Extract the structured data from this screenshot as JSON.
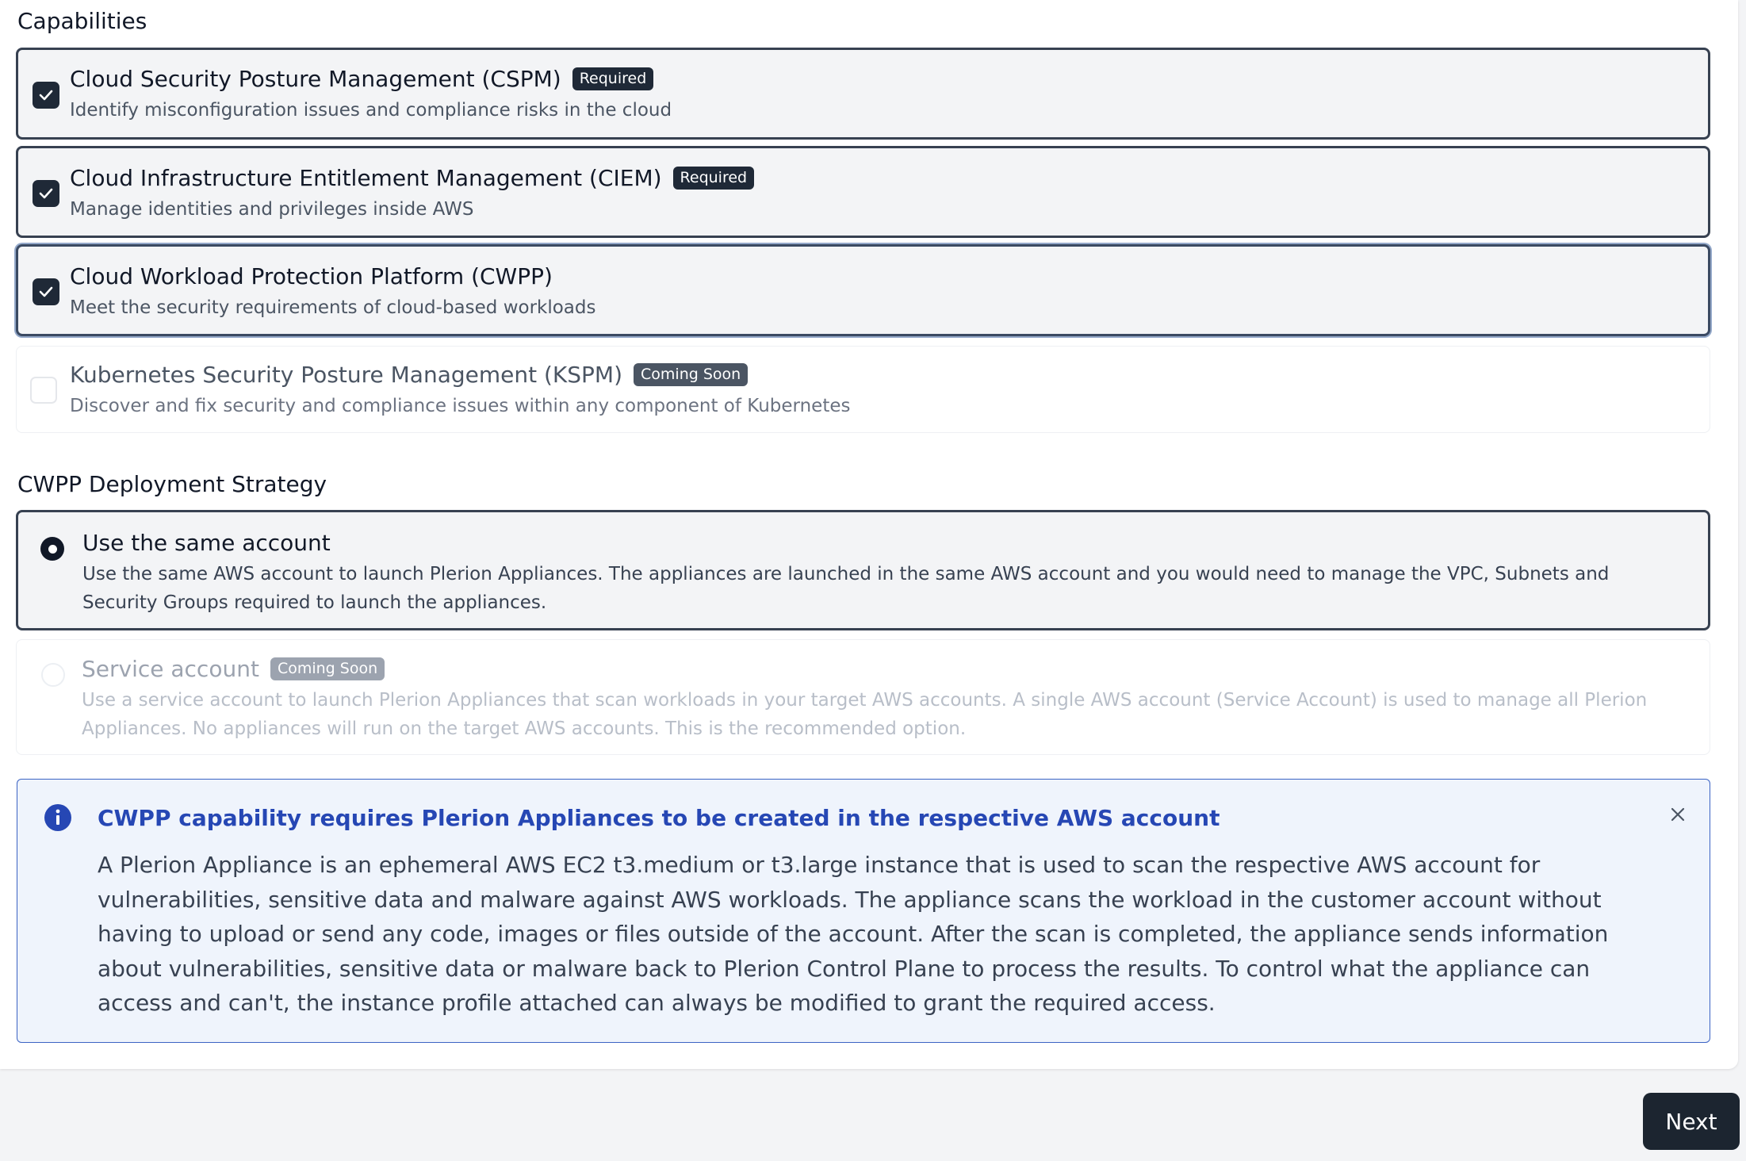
{
  "capabilities": {
    "heading": "Capabilities",
    "items": [
      {
        "title": "Cloud Security Posture Management (CSPM)",
        "badge": "Required",
        "description": "Identify misconfiguration issues and compliance risks in the cloud",
        "checked": true
      },
      {
        "title": "Cloud Infrastructure Entitlement Management (CIEM)",
        "badge": "Required",
        "description": "Manage identities and privileges inside AWS",
        "checked": true
      },
      {
        "title": "Cloud Workload Protection Platform (CWPP)",
        "badge": "",
        "description": "Meet the security requirements of cloud-based workloads",
        "checked": true
      },
      {
        "title": "Kubernetes Security Posture Management (KSPM)",
        "badge": "Coming Soon",
        "description": "Discover and fix security and compliance issues within any component of Kubernetes",
        "checked": false
      }
    ]
  },
  "deployment": {
    "heading": "CWPP Deployment Strategy",
    "options": [
      {
        "title": "Use the same account",
        "badge": "",
        "description": "Use the same AWS account to launch Plerion Appliances. The appliances are launched in the same AWS account and you would need to manage the VPC, Subnets and Security Groups required to launch the appliances.",
        "selected": true
      },
      {
        "title": "Service account",
        "badge": "Coming Soon",
        "description": "Use a service account to launch Plerion Appliances that scan workloads in your target AWS accounts. A single AWS account (Service Account) is used to manage all Plerion Appliances. No appliances will run on the target AWS accounts. This is the recommended option.",
        "selected": false
      }
    ]
  },
  "alert": {
    "title": "CWPP capability requires Plerion Appliances to be created in the respective AWS account",
    "body": "A Plerion Appliance is an ephemeral AWS EC2 t3.medium or t3.large instance that is used to scan the respective AWS account for vulnerabilities, sensitive data and malware against AWS workloads. The appliance scans the workload in the customer account without having to upload or send any code, images or files outside of the account. After the scan is completed, the appliance sends information about vulnerabilities, sensitive data or malware back to Plerion Control Plane to process the results. To control what the appliance can access and can't, the instance profile attached can always be modified to grant the required access.",
    "icon": "info-icon",
    "color": "#2647b4"
  },
  "footer": {
    "next_label": "Next"
  }
}
